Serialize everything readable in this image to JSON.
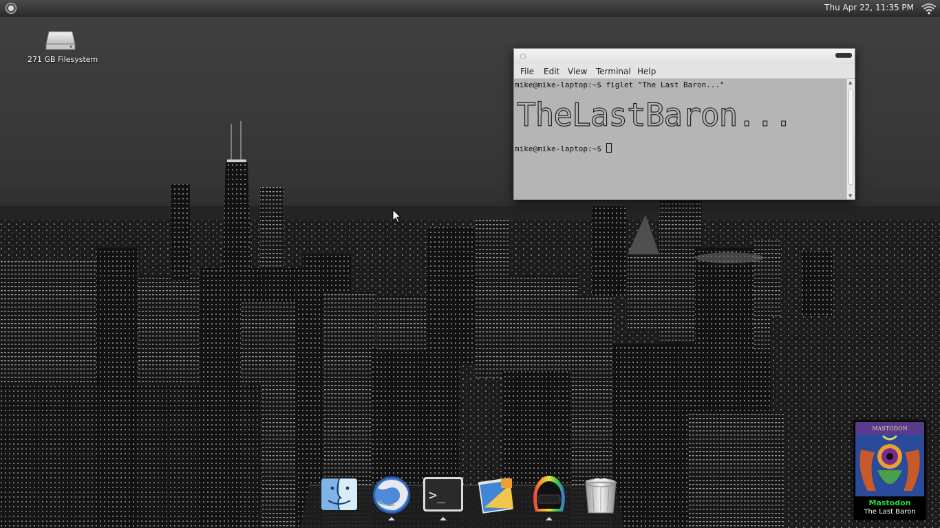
{
  "top_panel": {
    "clock": "Thu Apr 22, 11:35 PM",
    "menu_icon": "system-menu-icon",
    "network_icon": "wifi-icon"
  },
  "desktop": {
    "icons": [
      {
        "label": "271 GB Filesystem",
        "icon": "hard-drive-icon"
      }
    ]
  },
  "terminal": {
    "menu": [
      "File",
      "Edit",
      "View",
      "Terminal",
      "Help"
    ],
    "lines": [
      "mike@mike-laptop:~$ figlet \"The Last Baron...\"",
      "mike@mike-laptop:~$ "
    ],
    "figlet_output": "TheLastBaron...",
    "background": "#b5b5b5"
  },
  "dock": {
    "items": [
      {
        "icon": "finder-icon",
        "running": false
      },
      {
        "icon": "firefox-icon",
        "running": true
      },
      {
        "icon": "terminal-icon",
        "running": true
      },
      {
        "icon": "mail-icon",
        "running": false
      },
      {
        "icon": "music-player-icon",
        "running": true
      },
      {
        "icon": "trash-icon",
        "running": false
      }
    ],
    "terminal_glyph": ">_"
  },
  "now_playing": {
    "artist": "Mastodon",
    "track": "The Last Baron",
    "artist_color": "#1fdc3a"
  }
}
